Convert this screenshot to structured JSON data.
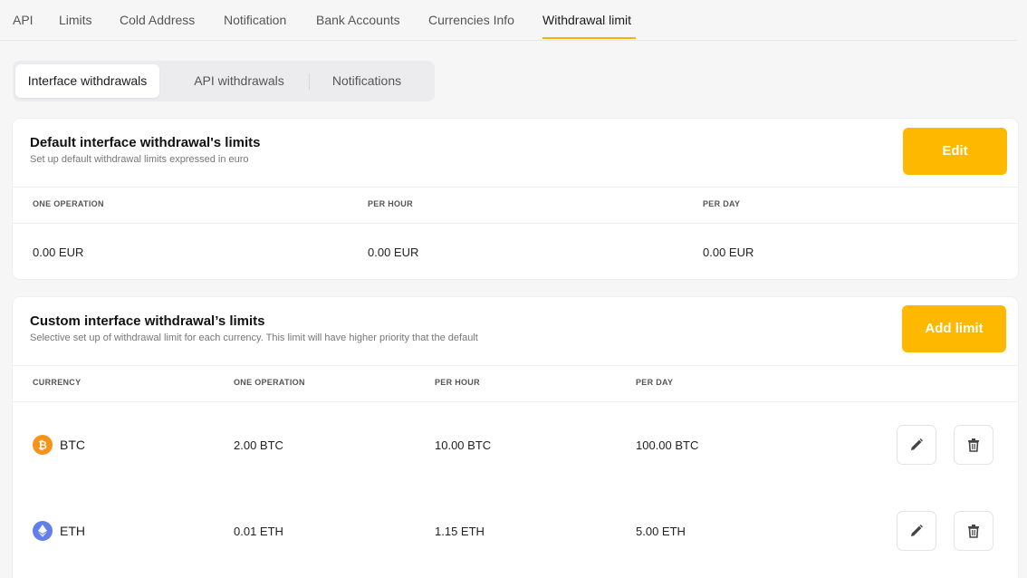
{
  "topnav": {
    "tabs": [
      {
        "label": "API"
      },
      {
        "label": "Limits"
      },
      {
        "label": "Cold Address"
      },
      {
        "label": "Notification"
      },
      {
        "label": "Bank Accounts"
      },
      {
        "label": "Currencies Info"
      },
      {
        "label": "Withdrawal limit",
        "active": true
      }
    ]
  },
  "subtabs": [
    {
      "label": "Interface withdrawals",
      "active": true
    },
    {
      "label": "API withdrawals"
    },
    {
      "label": "Notifications"
    }
  ],
  "default_limits": {
    "title": "Default interface withdrawal's limits",
    "subtitle": "Set up default withdrawal limits expressed in euro",
    "edit_label": "Edit",
    "columns": [
      "ONE OPERATION",
      "PER HOUR",
      "PER DAY"
    ],
    "values": [
      "0.00 EUR",
      "0.00 EUR",
      "0.00 EUR"
    ]
  },
  "custom_limits": {
    "title": "Custom interface withdrawal’s limits",
    "subtitle": "Selective set up of withdrawal limit for each currency. This limit will have higher priority that the default",
    "add_label": "Add limit",
    "columns": [
      "CURRENCY",
      "ONE OPERATION",
      "PER HOUR",
      "PER DAY"
    ],
    "rows": [
      {
        "currency": "BTC",
        "icon": "bitcoin-icon",
        "one_operation": "2.00 BTC",
        "per_hour": "10.00 BTC",
        "per_day": "100.00 BTC"
      },
      {
        "currency": "ETH",
        "icon": "ethereum-icon",
        "one_operation": "0.01 ETH",
        "per_hour": "1.15 ETH",
        "per_day": "5.00 ETH"
      }
    ]
  },
  "colors": {
    "accent": "#ffb800",
    "tab_underline": "#f5b400",
    "btc": "#f7931a",
    "eth": "#627eea"
  }
}
